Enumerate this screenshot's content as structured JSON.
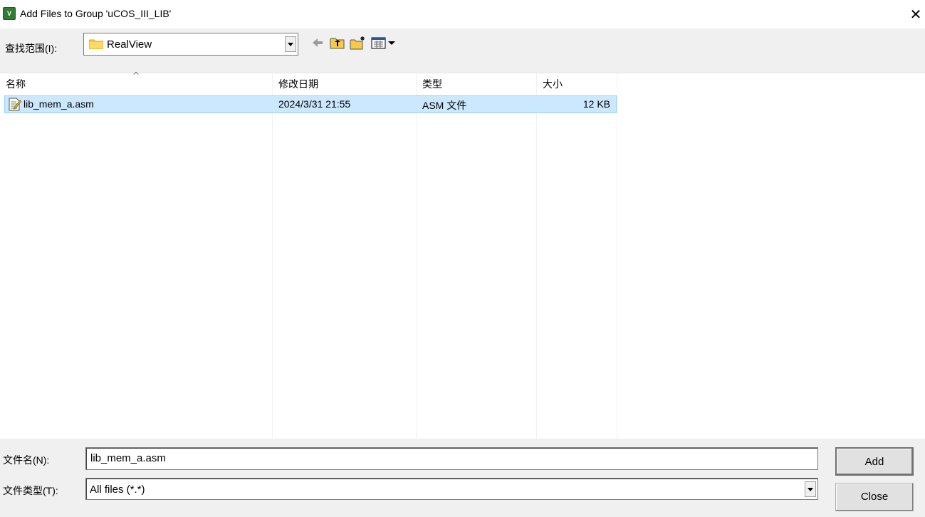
{
  "window": {
    "title": "Add Files to Group 'uCOS_III_LIB'",
    "app_icon_text": "V",
    "close_glyph": "✕"
  },
  "toolbar": {
    "look_in_label": "查找范围(I):",
    "look_in_value": "RealView",
    "icons": [
      "back-arrow-icon",
      "up-folder-icon",
      "new-folder-icon",
      "view-menu-icon"
    ]
  },
  "list": {
    "sort_glyph": "^",
    "columns": [
      "名称",
      "修改日期",
      "类型",
      "大小"
    ],
    "rows": [
      {
        "name": "lib_mem_a.asm",
        "modified": "2024/3/31 21:55",
        "type": "ASM 文件",
        "size": "12 KB",
        "selected": true
      }
    ]
  },
  "form": {
    "file_name_label": "文件名(N):",
    "file_name_value": "lib_mem_a.asm",
    "file_type_label": "文件类型(T):",
    "file_type_value": "All files (*.*)"
  },
  "buttons": {
    "add_label": "Add",
    "close_label": "Close"
  },
  "colors": {
    "selection_bg": "#cce8ff",
    "selection_border": "#99d1ff",
    "folder_yellow": "#f7c948"
  }
}
